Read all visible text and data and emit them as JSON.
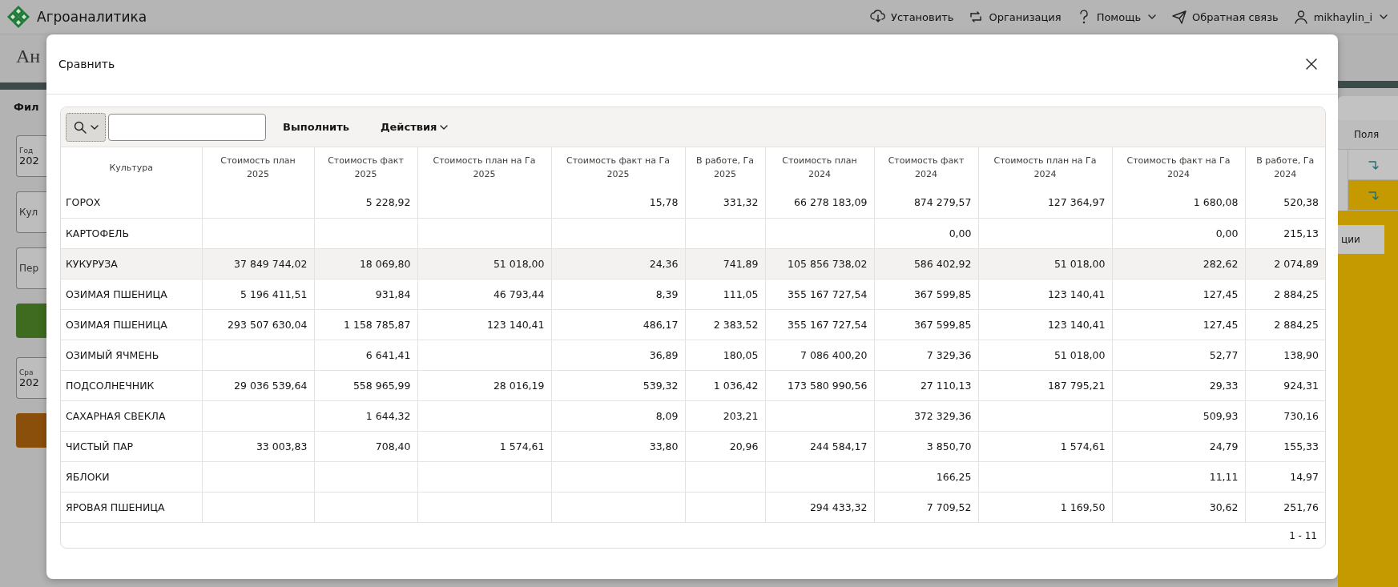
{
  "app": {
    "title": "Агроаналитика",
    "nav": [
      {
        "kind": "install",
        "label": "Установить",
        "caret": false
      },
      {
        "kind": "org",
        "label": "Организация",
        "caret": false
      },
      {
        "kind": "help",
        "label": "Помощь",
        "caret": true
      },
      {
        "kind": "feedback",
        "label": "Обратная связь",
        "caret": false
      },
      {
        "kind": "user",
        "label": "mikhaylin_i",
        "caret": true
      }
    ]
  },
  "background": {
    "page_title": "Ан",
    "filters_label": "Фил",
    "left_items": [
      {
        "kind": "field",
        "label": "Год",
        "value": "202"
      },
      {
        "kind": "field",
        "label": "Кул"
      },
      {
        "kind": "field",
        "label": "Пер"
      },
      {
        "kind": "button",
        "color": "#3e6b1f"
      },
      {
        "kind": "field",
        "label": "Сра",
        "value": "202"
      },
      {
        "kind": "button",
        "color": "#8a4f0b"
      }
    ],
    "right": {
      "column_header": "Поля",
      "rows": [
        {
          "selected": false
        },
        {
          "selected": true
        }
      ],
      "tab_label": "ции"
    }
  },
  "dialog": {
    "title": "Сравнить",
    "execute_button": "Выполнить",
    "actions_menu": "Действия",
    "columns": [
      {
        "label": "Культура"
      },
      {
        "label": "Стоимость план",
        "year": "2025"
      },
      {
        "label": "Стоимость факт",
        "year": "2025"
      },
      {
        "label": "Стоимость план на Га",
        "year": "2025"
      },
      {
        "label": "Стоимость факт на Га",
        "year": "2025"
      },
      {
        "label": "В работе, Га",
        "year": "2025"
      },
      {
        "label": "Стоимость план",
        "year": "2024"
      },
      {
        "label": "Стоимость факт",
        "year": "2024"
      },
      {
        "label": "Стоимость план на Га",
        "year": "2024"
      },
      {
        "label": "Стоимость факт на Га",
        "year": "2024"
      },
      {
        "label": "В работе, Га",
        "year": "2024"
      }
    ],
    "rows": [
      {
        "highlighted": false,
        "cells": [
          "ГОРОХ",
          null,
          "5 228,92",
          null,
          "15,78",
          "331,32",
          "66 278 183,09",
          "874 279,57",
          "127 364,97",
          "1 680,08",
          "520,38"
        ]
      },
      {
        "highlighted": false,
        "cells": [
          "КАРТОФЕЛЬ",
          null,
          null,
          null,
          null,
          null,
          null,
          "0,00",
          null,
          "0,00",
          "215,13"
        ]
      },
      {
        "highlighted": true,
        "cells": [
          "КУКУРУЗА",
          "37 849 744,02",
          "18 069,80",
          "51 018,00",
          "24,36",
          "741,89",
          "105 856 738,02",
          "586 402,92",
          "51 018,00",
          "282,62",
          "2 074,89"
        ]
      },
      {
        "highlighted": false,
        "cells": [
          "ОЗИМАЯ ПШЕНИЦА",
          "5 196 411,51",
          "931,84",
          "46 793,44",
          "8,39",
          "111,05",
          "355 167 727,54",
          "367 599,85",
          "123 140,41",
          "127,45",
          "2 884,25"
        ]
      },
      {
        "highlighted": false,
        "cells": [
          "ОЗИМАЯ ПШЕНИЦА",
          "293 507 630,04",
          "1 158 785,87",
          "123 140,41",
          "486,17",
          "2 383,52",
          "355 167 727,54",
          "367 599,85",
          "123 140,41",
          "127,45",
          "2 884,25"
        ]
      },
      {
        "highlighted": false,
        "cells": [
          "ОЗИМЫЙ ЯЧМЕНЬ",
          null,
          "6 641,41",
          null,
          "36,89",
          "180,05",
          "7 086 400,20",
          "7 329,36",
          "51 018,00",
          "52,77",
          "138,90"
        ]
      },
      {
        "highlighted": false,
        "cells": [
          "ПОДСОЛНЕЧНИК",
          "29 036 539,64",
          "558 965,99",
          "28 016,19",
          "539,32",
          "1 036,42",
          "173 580 990,56",
          "27 110,13",
          "187 795,21",
          "29,33",
          "924,31"
        ]
      },
      {
        "highlighted": false,
        "cells": [
          "САХАРНАЯ СВЕКЛА",
          null,
          "1 644,32",
          null,
          "8,09",
          "203,21",
          null,
          "372 329,36",
          null,
          "509,93",
          "730,16"
        ]
      },
      {
        "highlighted": false,
        "cells": [
          "ЧИСТЫЙ ПАР",
          "33 003,83",
          "708,40",
          "1 574,61",
          "33,80",
          "20,96",
          "244 584,17",
          "3 850,70",
          "1 574,61",
          "24,79",
          "155,33"
        ]
      },
      {
        "highlighted": false,
        "cells": [
          "ЯБЛОКИ",
          null,
          null,
          null,
          null,
          null,
          null,
          "166,25",
          null,
          "11,11",
          "14,97"
        ]
      },
      {
        "highlighted": false,
        "cells": [
          "ЯРОВАЯ ПШЕНИЦА",
          null,
          null,
          null,
          null,
          null,
          "294 433,32",
          "7 709,52",
          "1 169,50",
          "30,62",
          "251,76"
        ]
      }
    ],
    "pagination": "1 - 11"
  }
}
